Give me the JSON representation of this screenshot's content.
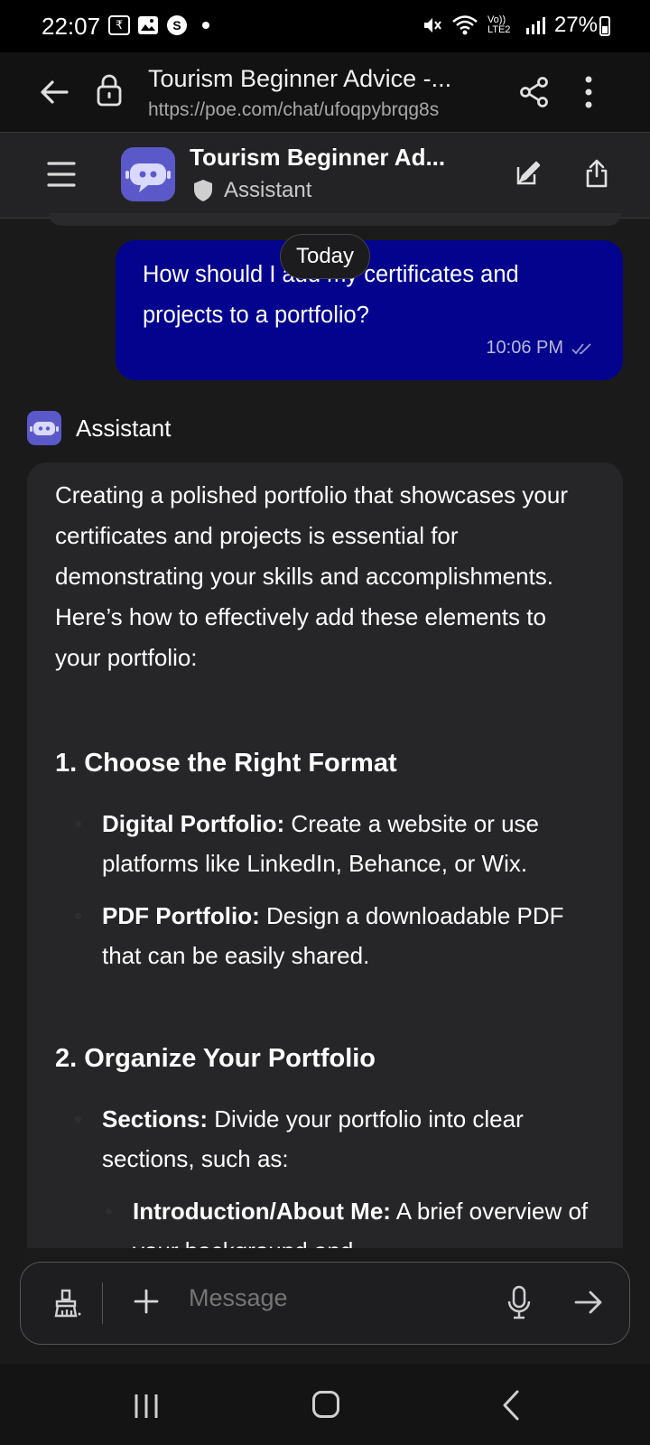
{
  "status_bar": {
    "time": "22:07",
    "icon_box_label": "₹",
    "network_label": "Vo)) LTE2",
    "battery": "27%"
  },
  "browser": {
    "title": "Tourism Beginner Advice -...",
    "url": "https://poe.com/chat/ufoqpybrqg8s"
  },
  "header": {
    "bot_title": "Tourism Beginner Ad...",
    "bot_subtitle": "Assistant"
  },
  "chat": {
    "date_divider": "Today",
    "user_message": "How should I add my certificates and projects to a portfolio?",
    "user_time": "10:06 PM",
    "bot_name": "Assistant",
    "response": {
      "intro": "Creating a polished portfolio that showcases your certificates and projects is essential for demonstrating your skills and accomplishments. Here’s how to effectively add these elements to your portfolio:",
      "section1_title": "1. Choose the Right Format",
      "s1_item1_bold": "Digital Portfolio:",
      "s1_item1_text": " Create a website or use platforms like LinkedIn, Behance, or Wix.",
      "s1_item2_bold": "PDF Portfolio:",
      "s1_item2_text": " Design a downloadable PDF that can be easily shared.",
      "section2_title": "2. Organize Your Portfolio",
      "s2_item1_bold": "Sections:",
      "s2_item1_text": " Divide your portfolio into clear sections, such as:",
      "s2_sub1_bold": "Introduction/About Me:",
      "s2_sub1_text": " A brief overview of your background and"
    }
  },
  "composer": {
    "placeholder": "Message"
  }
}
